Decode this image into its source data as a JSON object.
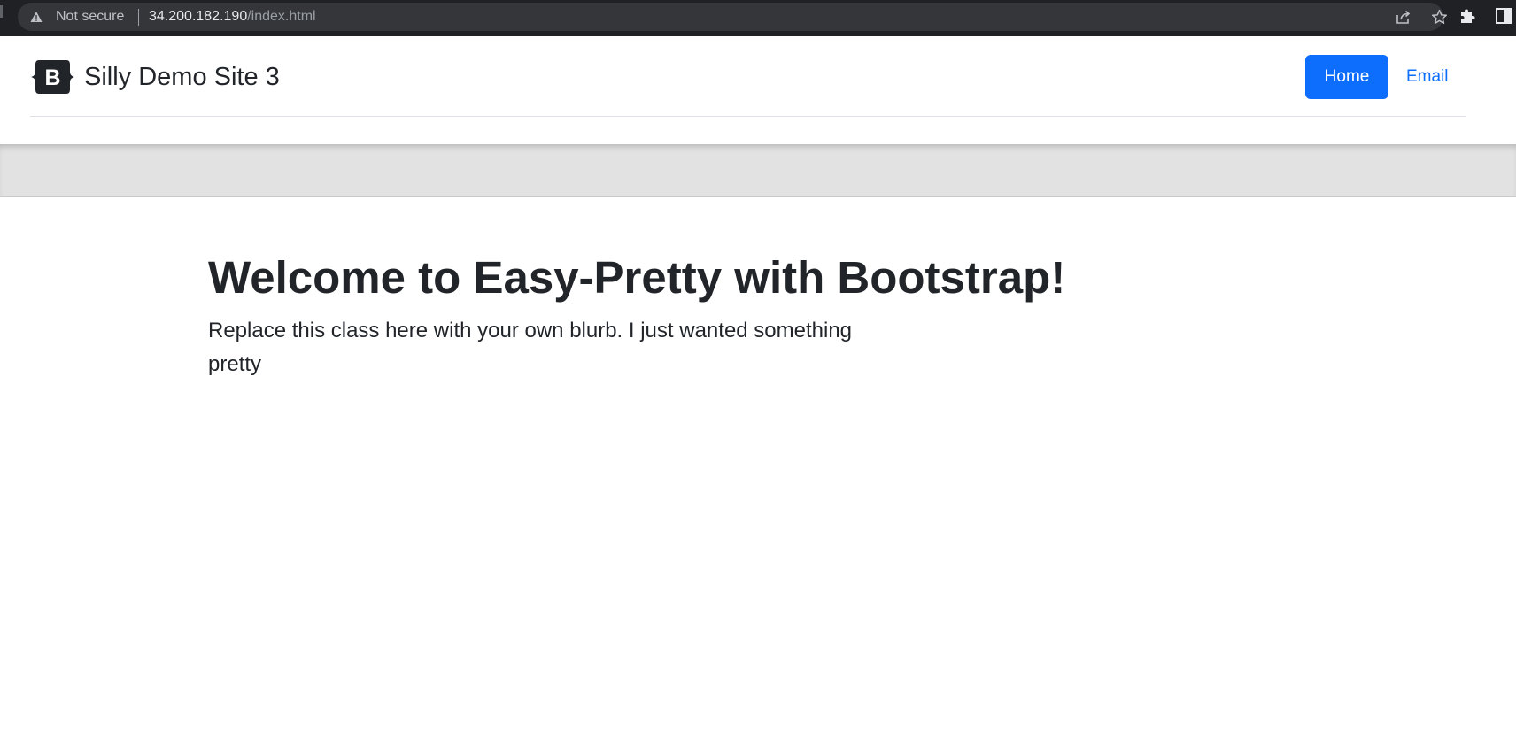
{
  "browser": {
    "security_label": "Not secure",
    "url_host": "34.200.182.190",
    "url_path": "/index.html",
    "icons": [
      "warning-icon",
      "share-icon",
      "star-icon",
      "puzzle-icon",
      "side-panel-icon"
    ]
  },
  "site": {
    "brand_name": "Silly Demo Site 3",
    "brand_logo_letter": "B",
    "nav": {
      "home_label": "Home",
      "email_label": "Email"
    },
    "colors": {
      "primary": "#0d6efd",
      "text": "#212529",
      "band": "#e2e2e2"
    }
  },
  "hero": {
    "title": "Welcome to Easy-Pretty with Bootstrap!",
    "lead": "Replace this class here with your own blurb. I just wanted something pretty"
  }
}
